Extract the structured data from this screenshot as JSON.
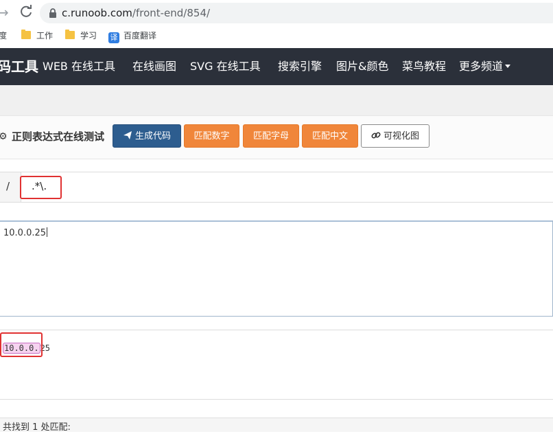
{
  "browser": {
    "url_host": "c.runoob.com",
    "url_path": "/front-end/854/",
    "bookmarks": [
      {
        "label": "度"
      },
      {
        "label": "工作"
      },
      {
        "label": "学习"
      },
      {
        "label": "百度翻译",
        "icon_text": "译"
      }
    ]
  },
  "navbar": {
    "brand": "码工具",
    "items": [
      "WEB 在线工具",
      "在线画图",
      "SVG 在线工具",
      "搜索引擎",
      "图片&颜色",
      "菜鸟教程",
      "更多频道"
    ]
  },
  "toolbar": {
    "title": "正则表达式在线测试",
    "buttons": {
      "generate": "生成代码",
      "match_digits": "匹配数字",
      "match_letters": "匹配字母",
      "match_chinese": "匹配中文",
      "visualize": "可视化图"
    }
  },
  "regex": {
    "delimiter": "/",
    "pattern": ".*\\."
  },
  "input": {
    "text": "10.0.0.25"
  },
  "result": {
    "match": "10.0.0.",
    "rest": "25"
  },
  "footer": {
    "summary": "共找到 1 处匹配:"
  },
  "colors": {
    "navbar_bg": "#2b303a",
    "btn_blue": "#2d5d8f",
    "btn_orange": "#f0863a",
    "highlight_red": "#e03131",
    "match_bg": "#f6d3f0"
  }
}
